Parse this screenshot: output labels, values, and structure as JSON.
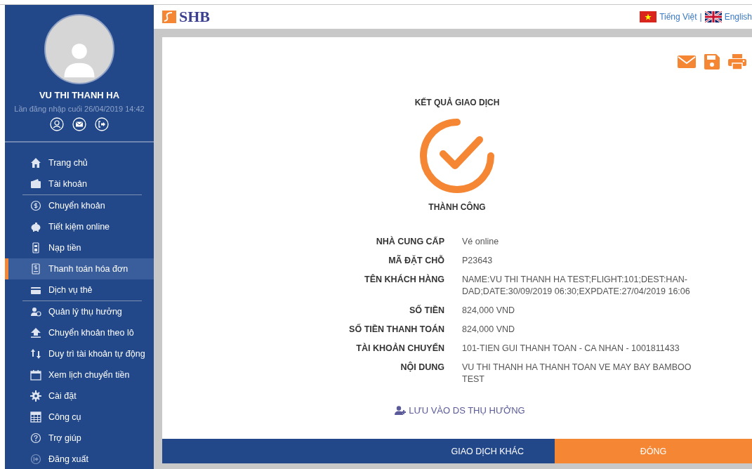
{
  "user": {
    "name": "VU THI THANH HA",
    "last_login": "Lần đăng nhập cuối 26/04/2019 14:42"
  },
  "menu_sections": [
    {
      "items": [
        {
          "label": "Trang chủ",
          "selected": false
        },
        {
          "label": "Tài khoản",
          "selected": false
        }
      ]
    },
    {
      "items": [
        {
          "label": "Chuyển khoản",
          "selected": false
        },
        {
          "label": "Tiết kiệm online",
          "selected": false
        },
        {
          "label": "Nạp tiền",
          "selected": false
        },
        {
          "label": "Thanh toán hóa đơn",
          "selected": true
        },
        {
          "label": "Dịch vụ thẻ",
          "selected": false
        }
      ]
    },
    {
      "items": [
        {
          "label": "Quản lý thụ hưởng",
          "selected": false
        },
        {
          "label": "Chuyển khoản theo lô",
          "selected": false
        },
        {
          "label": "Duy trì tài khoản tự động",
          "selected": false
        },
        {
          "label": "Xem lịch chuyển tiền",
          "selected": false
        },
        {
          "label": "Cài đặt",
          "selected": false
        },
        {
          "label": "Công cụ",
          "selected": false
        },
        {
          "label": "Trợ giúp",
          "selected": false
        },
        {
          "label": "Đăng xuất",
          "selected": false
        }
      ]
    }
  ],
  "header": {
    "logo": "SHB",
    "languages": [
      {
        "label": "Tiếng Việt"
      },
      {
        "label": "English"
      }
    ],
    "separator": "|"
  },
  "result": {
    "title": "KẾT QUẢ GIAO DỊCH",
    "status": "THÀNH CÔNG",
    "details": [
      {
        "label": "NHÀ CUNG CẤP",
        "value": "Vé online"
      },
      {
        "label": "MÃ ĐẶT CHỖ",
        "value": "P23643"
      },
      {
        "label": "TÊN KHÁCH HÀNG",
        "value": "NAME:VU THI THANH HA TEST;FLIGHT:101;DEST:HAN-DAD;DATE:30/09/2019 06:30;EXPDATE:27/04/2019 16:06"
      },
      {
        "label": "SỐ TIỀN",
        "value": "824,000 VND"
      },
      {
        "label": "SỐ TIỀN THANH TOÁN",
        "value": "824,000 VND"
      },
      {
        "label": "TÀI KHOẢN CHUYỂN",
        "value": "101-TIEN GUI THANH TOAN - CA NHAN - 1001811433"
      },
      {
        "label": "NỘI DUNG",
        "value": "VU THI THANH HA THANH TOAN VE MAY BAY BAMBOO TEST"
      }
    ],
    "save_link": "LƯU VÀO DS THỤ HƯỞNG"
  },
  "buttons": [
    {
      "label": "GIAO DỊCH KHÁC",
      "kind": "secondary"
    },
    {
      "label": "ĐÓNG",
      "kind": "primary"
    }
  ]
}
